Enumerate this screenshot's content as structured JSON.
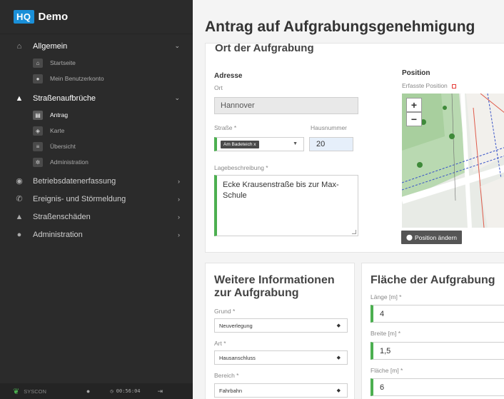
{
  "brand": {
    "logo": "HQ",
    "name": "Demo"
  },
  "sidebar": {
    "groups": [
      {
        "label": "Allgemein",
        "icon": "home-icon",
        "arrow": "⌄"
      },
      {
        "label": "Straßenaufbrüche",
        "icon": "road-icon",
        "arrow": "⌄"
      },
      {
        "label": "Betriebsdatenerfassung",
        "icon": "gauge-icon",
        "arrow": "›"
      },
      {
        "label": "Ereignis- und Störmeldung",
        "icon": "phone-icon",
        "arrow": "›"
      },
      {
        "label": "Straßenschäden",
        "icon": "road-icon",
        "arrow": "›"
      },
      {
        "label": "Administration",
        "icon": "users-icon",
        "arrow": "›"
      }
    ],
    "allgemein_items": [
      {
        "label": "Startseite",
        "icon": "home-icon"
      },
      {
        "label": "Mein Benutzerkonto",
        "icon": "user-icon"
      }
    ],
    "strassen_items": [
      {
        "label": "Antrag",
        "icon": "document-icon"
      },
      {
        "label": "Karte",
        "icon": "map-icon"
      },
      {
        "label": "Übersicht",
        "icon": "list-icon"
      },
      {
        "label": "Administration",
        "icon": "gear-icon"
      }
    ]
  },
  "footer": {
    "company": "SYSCON",
    "timer": "00:56:04"
  },
  "page": {
    "title": "Antrag auf Aufgrabungsgenehmigung"
  },
  "ort": {
    "section_title": "Ort der Aufgrabung",
    "adresse_label": "Adresse",
    "ort_label": "Ort",
    "ort_value": "Hannover",
    "strasse_label": "Straße *",
    "strasse_tag": "Am Badeteich x",
    "hausnummer_label": "Hausnummer",
    "hausnummer_value": "20",
    "lage_label": "Lagebeschreibung *",
    "lage_value": "Ecke Krausenstraße bis zur Max-Schule",
    "position_label": "Position",
    "erfasste_label": "Erfasste Position",
    "zoom_in": "+",
    "zoom_out": "−",
    "position_button": "Position ändern"
  },
  "weitere": {
    "title": "Weitere Informationen zur Aufgrabung",
    "grund_label": "Grund *",
    "grund_value": "Neuverlegung",
    "art_label": "Art *",
    "art_value": "Hausanschluss",
    "bereich_label": "Bereich *",
    "bereich_value": "Fahrbahn"
  },
  "flaeche": {
    "title": "Fläche der Aufgrabung",
    "laenge_label": "Länge [m] *",
    "laenge_value": "4",
    "breite_label": "Breite [m] *",
    "breite_value": "1,5",
    "flaeche_label": "Fläche [m] *",
    "flaeche_value": "6"
  },
  "colors": {
    "accent": "#1a8fd8",
    "valid": "#4caf50",
    "sidebar": "#2b2b2b"
  }
}
